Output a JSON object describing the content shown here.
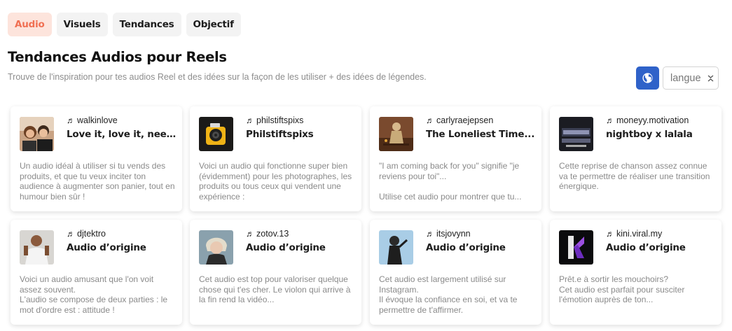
{
  "tabs": [
    {
      "label": "Audio",
      "active": true
    },
    {
      "label": "Visuels",
      "active": false
    },
    {
      "label": "Tendances",
      "active": false
    },
    {
      "label": "Objectif",
      "active": false
    }
  ],
  "header": {
    "title": "Tendances Audios pour Reels",
    "subtitle": "Trouve de l'inspiration pour tes audios Reel et des idées sur la façon de les utiliser + des idées de légendes."
  },
  "language": {
    "selected": "langue",
    "icon": "globe-icon"
  },
  "colors": {
    "accent": "#f06f52",
    "accent_bg": "#fde4dc",
    "button_blue": "#2f62c9"
  },
  "cards": [
    {
      "handle": "walkinlove",
      "title": "Love it, love it, need...",
      "description": "Un audio idéal à utiliser si tu vends des produits, et que tu veux inciter ton audience à augmenter son panier, tout en humour bien sûr !"
    },
    {
      "handle": "philstiftspixs",
      "title": "Philstiftspixs",
      "description": "Voici un audio qui fonctionne super bien (évidemment) pour les photographes, les produits ou tous ceux qui vendent une expérience :"
    },
    {
      "handle": "carlyraejepsen",
      "title": "The Loneliest Time...",
      "description": "\"I am coming back for you\" signifie \"je reviens pour toi\"...\n\nUtilise cet audio pour montrer que tu..."
    },
    {
      "handle": "moneyy.motivation",
      "title": "nightboy x lalala",
      "description": "Cette reprise de chanson assez connue va te permettre de réaliser une transition énergique."
    },
    {
      "handle": "djtektro",
      "title": "Audio d’origine",
      "description": "Voici un audio amusant que l'on voit assez souvent.\nL'audio se compose de deux parties : le mot d'ordre est : attitude !"
    },
    {
      "handle": "zotov.13",
      "title": "Audio d’origine",
      "description": "Cet audio est top pour valoriser quelque chose qui t'es cher. Le violon qui arrive à la fin rend la vidéo..."
    },
    {
      "handle": "itsjovynn",
      "title": "Audio d’origine",
      "description": "Cet audio est largement utilisé sur Instagram.\nIl évoque la confiance en soi, et va te permettre de t'affirmer."
    },
    {
      "handle": "kini.viral.my",
      "title": "Audio d’origine",
      "description": "Prêt.e à sortir les mouchoirs?\nCet audio est parfait pour susciter l'émotion auprès de ton..."
    }
  ]
}
